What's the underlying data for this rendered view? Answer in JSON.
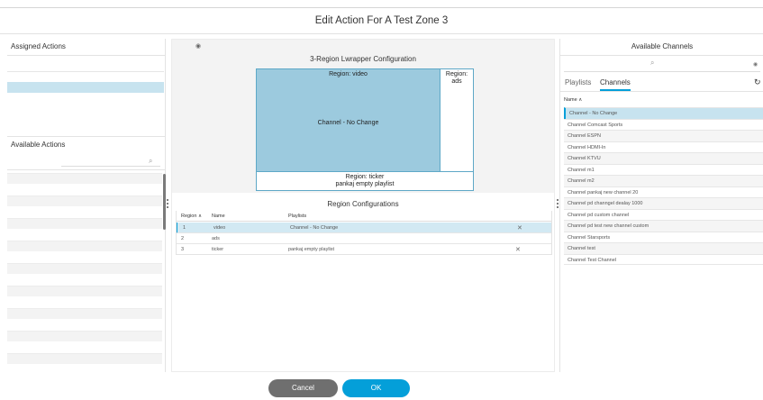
{
  "dialog": {
    "title": "Edit Action For A Test Zone 3"
  },
  "left": {
    "assigned_title": "Assigned Actions",
    "available_title": "Available Actions",
    "search_icon": "magnifier-icon"
  },
  "center": {
    "eye_icon": "eye-icon",
    "config_title": "3-Region Lwrapper Configuration",
    "regions": {
      "video_label": "Region: video",
      "video_content": "Channel - No Change",
      "ads_label": "Region: ads",
      "ticker_label": "Region: ticker",
      "ticker_content": "pankaj empty playlist"
    },
    "region_config_title": "Region Configurations",
    "table": {
      "headers": {
        "region": "Region",
        "name": "Name",
        "playlists": "Playlists"
      },
      "rows": [
        {
          "region": "1",
          "name": "video",
          "playlist": "Channel - No Change",
          "remove": "✕"
        },
        {
          "region": "2",
          "name": "ads",
          "playlist": "",
          "remove": ""
        },
        {
          "region": "3",
          "name": "ticker",
          "playlist": "pankaj empty playlist",
          "remove": "✕"
        }
      ]
    }
  },
  "right": {
    "title": "Available Channels",
    "tabs": {
      "playlists": "Playlists",
      "channels": "Channels"
    },
    "column_header": "Name",
    "channels": [
      "Channel - No Change",
      "Channel Comcast Sports",
      "Channel ESPN",
      "Channel HDMI-In",
      "Channel KTVU",
      "Channel m1",
      "Channel m2",
      "Channel pankaj new channel 20",
      "Channel pd channgel dealay 1000",
      "Channel pd custom channel",
      "Channel pd test new channel custom",
      "Channel Starsports",
      "Channel test",
      "Channel Test Channel"
    ]
  },
  "footer": {
    "cancel": "Cancel",
    "ok": "OK"
  },
  "colors": {
    "accent": "#049fd9",
    "selection": "#c7e3ef",
    "region_fill": "#9ccade"
  }
}
